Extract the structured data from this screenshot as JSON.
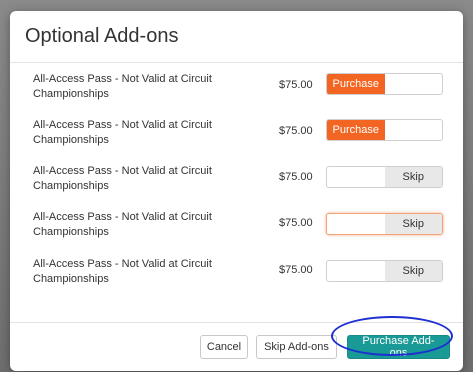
{
  "modal": {
    "title": "Optional Add-ons"
  },
  "addons": [
    {
      "name": "All-Access Pass - Not Valid at Circuit Championships",
      "price": "$75.00",
      "selected": "purchase",
      "purchase_label": "Purchase",
      "skip_label": ""
    },
    {
      "name": "All-Access Pass - Not Valid at Circuit Championships",
      "price": "$75.00",
      "selected": "purchase",
      "purchase_label": "Purchase",
      "skip_label": ""
    },
    {
      "name": "All-Access Pass - Not Valid at Circuit Championships",
      "price": "$75.00",
      "selected": "skip",
      "purchase_label": "",
      "skip_label": "Skip"
    },
    {
      "name": "All-Access Pass - Not Valid at Circuit Championships",
      "price": "$75.00",
      "selected": "skip",
      "purchase_label": "",
      "skip_label": "Skip"
    },
    {
      "name": "All-Access Pass - Not Valid at Circuit Championships",
      "price": "$75.00",
      "selected": "skip",
      "purchase_label": "",
      "skip_label": "Skip"
    }
  ],
  "footer": {
    "cancel_label": "Cancel",
    "skip_label": "Skip Add-ons",
    "purchase_label": "Purchase Add-ons"
  },
  "colors": {
    "purchase_active": "#f26522",
    "primary_button": "#1a9a96",
    "highlight_ring": "#1d2fd0"
  }
}
